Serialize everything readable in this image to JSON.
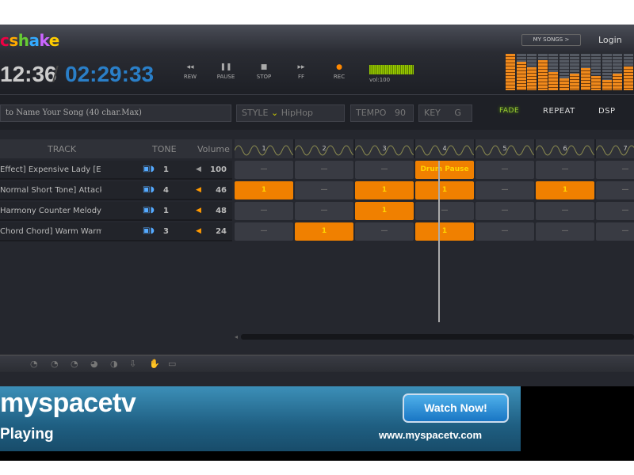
{
  "header": {
    "logo": "cshake",
    "logo_colors": [
      "#e04",
      "#fa0",
      "#6c3",
      "#3af",
      "#c6f",
      "#fc0",
      "#3cf"
    ],
    "elapsed": "12:36",
    "separator": "/",
    "total": "02:29:33",
    "transport": [
      {
        "icon": "rewind-icon",
        "glyph": "◂◂",
        "label": "REW"
      },
      {
        "icon": "pause-icon",
        "glyph": "❚❚",
        "label": "PAUSE"
      },
      {
        "icon": "stop-icon",
        "glyph": "■",
        "label": "STOP"
      },
      {
        "icon": "fast-forward-icon",
        "glyph": "▸▸",
        "label": "FF"
      },
      {
        "icon": "record-icon",
        "glyph": "●",
        "label": "REC"
      }
    ],
    "volume_label": "vol:100",
    "volume": 100,
    "my_songs": "MY SONGS  >",
    "login": "Login",
    "eq_levels": [
      1.0,
      0.78,
      0.62,
      0.82,
      0.5,
      0.32,
      0.45,
      0.6,
      0.4,
      0.28,
      0.45,
      0.65
    ]
  },
  "controls": {
    "song_name_placeholder": "to Name Your Song (40 char.Max)",
    "style_label": "STYLE",
    "style_value": "HipHop",
    "tempo_label": "TEMPO",
    "tempo_value": "90",
    "key_label": "KEY",
    "key_value": "G",
    "fade": "FADE",
    "repeat": "REPEAT",
    "dsp": "DSP"
  },
  "tracks": {
    "headers": {
      "track": "TRACK",
      "tone": "TONE",
      "volume": "Volume"
    },
    "rows": [
      {
        "name": "Effect] Expensive Lady    [E",
        "tone": "1",
        "volume": "100",
        "muted": true
      },
      {
        "name": "Normal Short Tone] Attack I",
        "tone": "4",
        "volume": "46",
        "muted": false
      },
      {
        "name": "Harmony Counter Melody] C",
        "tone": "1",
        "volume": "48",
        "muted": false
      },
      {
        "name": "Chord Chord] Warm Warm I",
        "tone": "3",
        "volume": "24",
        "muted": false
      }
    ]
  },
  "grid": {
    "bars": [
      "1",
      "2",
      "3",
      "4",
      "5",
      "6",
      "7"
    ],
    "rows": [
      [
        {
          "v": "—",
          "on": false
        },
        {
          "v": "—",
          "on": false
        },
        {
          "v": "—",
          "on": false
        },
        {
          "v": "Drum Pause",
          "on": true
        },
        {
          "v": "—",
          "on": false
        },
        {
          "v": "—",
          "on": false
        },
        {
          "v": "—",
          "on": false
        }
      ],
      [
        {
          "v": "1",
          "on": true
        },
        {
          "v": "—",
          "on": false
        },
        {
          "v": "1",
          "on": true
        },
        {
          "v": "1",
          "on": true
        },
        {
          "v": "—",
          "on": false
        },
        {
          "v": "1",
          "on": true
        },
        {
          "v": "—",
          "on": false
        }
      ],
      [
        {
          "v": "—",
          "on": false
        },
        {
          "v": "—",
          "on": false
        },
        {
          "v": "1",
          "on": true
        },
        {
          "v": "—",
          "on": false
        },
        {
          "v": "—",
          "on": false
        },
        {
          "v": "—",
          "on": false
        },
        {
          "v": "—",
          "on": false
        }
      ],
      [
        {
          "v": "—",
          "on": false
        },
        {
          "v": "1",
          "on": true
        },
        {
          "v": "—",
          "on": false
        },
        {
          "v": "1",
          "on": true
        },
        {
          "v": "—",
          "on": false
        },
        {
          "v": "—",
          "on": false
        },
        {
          "v": "—",
          "on": false
        }
      ]
    ]
  },
  "ad": {
    "brand": "myspacetv",
    "tagline": "Playing",
    "cta": "Watch Now!",
    "url": "www.myspacetv.com"
  }
}
